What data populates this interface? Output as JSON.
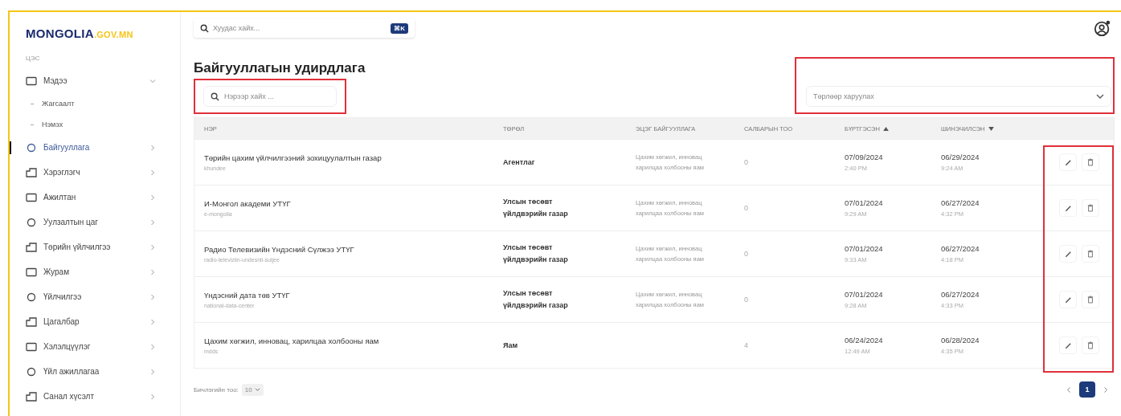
{
  "sidebar": {
    "logo": {
      "main": "MONGOLIA",
      "suffix": ".GOV.MN"
    },
    "section": "ЦЭС",
    "items": [
      {
        "label": "Мэдээ",
        "selected": false,
        "expanded": true,
        "children": [
          {
            "label": "Жагсаалт"
          },
          {
            "label": "Нэмэх"
          }
        ]
      },
      {
        "label": "Байгууллага",
        "selected": true,
        "expanded": false
      },
      {
        "label": "Хэрэглэгч",
        "selected": false,
        "expanded": false
      },
      {
        "label": "Ажилтан",
        "selected": false,
        "expanded": false
      },
      {
        "label": "Уулзалтын цаг",
        "selected": false,
        "expanded": false
      },
      {
        "label": "Төрийн үйлчилгээ",
        "selected": false,
        "expanded": false
      },
      {
        "label": "Журам",
        "selected": false,
        "expanded": false
      },
      {
        "label": "Үйлчилгээ",
        "selected": false,
        "expanded": false
      },
      {
        "label": "Цагалбар",
        "selected": false,
        "expanded": false
      },
      {
        "label": "Хэлэлцүүлэг",
        "selected": false,
        "expanded": false
      },
      {
        "label": "Үйл ажиллагаа",
        "selected": false,
        "expanded": false
      },
      {
        "label": "Санал хүсэлт",
        "selected": false,
        "expanded": false
      }
    ]
  },
  "topbar": {
    "search": {
      "placeholder": "Хуудас хайх..."
    },
    "shortcut": "⌘K"
  },
  "page": {
    "title": "Байгууллагын удирдлага",
    "search": {
      "placeholder": "Нэрээр хайх ...",
      "highlighted": true
    },
    "filter": {
      "placeholder": "Төрлөөр харуулах",
      "highlighted": true
    }
  },
  "table": {
    "columns": [
      {
        "label": "НЭР",
        "sorted": false
      },
      {
        "label": "ТӨРӨЛ",
        "sorted": false
      },
      {
        "label": "ЭЦЭГ БАЙГУУЛЛАГА",
        "sorted": false
      },
      {
        "label": "САЛБАРЫН ТОО",
        "sorted": false
      },
      {
        "label": "БҮРТГЭСЭН",
        "sorted": true,
        "ascending": true
      },
      {
        "label": "ШИНЭЧИЛСЭН",
        "sorted": true,
        "ascending": false
      }
    ],
    "actions_highlighted": true,
    "rows": [
      {
        "name": "Төрийн цахим үйлчилгээний зохицуулалтын газар",
        "slug": "khundee",
        "type": "Агентлаг",
        "parent": "Цахим хөгжил, инновац харилцаа холбооны яам",
        "count": "0",
        "created_date": "07/09/2024",
        "created_time": "2:40 PM",
        "updated_date": "06/29/2024",
        "updated_time": "9:24 AM"
      },
      {
        "name": "И-Монгол академи УТҮГ",
        "slug": "e-mongolia",
        "type": "Улсын төсөвт үйлдвэрийн газар",
        "parent": "Цахим хөгжил, инновац харилцаа холбооны яам",
        "count": "0",
        "created_date": "07/01/2024",
        "created_time": "9:29 AM",
        "updated_date": "06/27/2024",
        "updated_time": "4:32 PM"
      },
      {
        "name": "Радио Телевизийн Үндэсний Сүлжээ УТҮГ",
        "slug": "radio-televiziin-undesnii-suljee",
        "type": "Улсын төсөвт үйлдвэрийн газар",
        "parent": "Цахим хөгжил, инновац харилцаа холбооны яам",
        "count": "0",
        "created_date": "07/01/2024",
        "created_time": "9:33 AM",
        "updated_date": "06/27/2024",
        "updated_time": "4:18 PM"
      },
      {
        "name": "Үндэсний дата төв УТҮГ",
        "slug": "national-data-center",
        "type": "Улсын төсөвт үйлдвэрийн газар",
        "parent": "Цахим хөгжил, инновац харилцаа холбооны яам",
        "count": "0",
        "created_date": "07/01/2024",
        "created_time": "9:28 AM",
        "updated_date": "06/27/2024",
        "updated_time": "4:33 PM"
      },
      {
        "name": "Цахим хөгжил, инновац, харилцаа холбооны яам",
        "slug": "mdds",
        "type": "Яам",
        "count": "4",
        "created_date": "06/24/2024",
        "created_time": "12:49 AM",
        "updated_date": "06/28/2024",
        "updated_time": "4:35 PM"
      }
    ]
  },
  "footer": {
    "page_size_label": "Бичлэгийн тоо:",
    "page_size": "10",
    "pages": [
      {
        "label": "1",
        "selected": true
      }
    ]
  }
}
